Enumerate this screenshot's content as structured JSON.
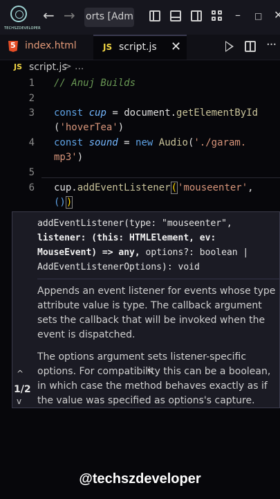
{
  "brand": {
    "logo_text": "TECHSZDEVELOPER"
  },
  "titlebar": {
    "back_icon": "←",
    "forward_icon": "→",
    "command_center_text": "orts [Admini"
  },
  "tabs": [
    {
      "label": "index.html",
      "icon": "html5-icon",
      "active": false
    },
    {
      "label": "script.js",
      "icon": "js-icon",
      "active": true,
      "close": "✕"
    }
  ],
  "breadcrumb": {
    "file": "script.js",
    "separator": ">",
    "more": "..."
  },
  "editor": {
    "line_numbers": [
      "1",
      "2",
      "3",
      "4",
      "5",
      "6"
    ],
    "line1": "// Anuj Builds",
    "line3": {
      "kw": "const",
      "var": "cup",
      "eq": " = ",
      "obj": "document.",
      "fn": "getElementById",
      "wrap_open": "(",
      "str": "'hoverTea'",
      "wrap_close": ")"
    },
    "line4": {
      "kw": "const",
      "var": "sound",
      "eq": " = ",
      "kw2": "new",
      "cls": "Audio",
      "open": "(",
      "str1": "'./garam.",
      "str2": "mp3'",
      "close": ")"
    },
    "line6": {
      "obj": "cup.",
      "fn": "addEventListener",
      "open": "(",
      "str": "'mouseenter'",
      "comma": ",",
      "cont": "()"
    }
  },
  "popup": {
    "signature_line1": "addEventListener(type: \"mouseenter\",",
    "signature_line2_bold": "listener: (this: HTMLElement, ev:",
    "signature_line3_bold": "MouseEvent) => any,",
    "signature_line3_rest": " options?: boolean |",
    "signature_line4": "AddEventListenerOptions): void",
    "doc1": "Appends an event listener for events whose type attribute value is type. The callback argument sets the callback that will be invoked when the event is dispatched.",
    "doc2": "The options argument sets listener-specific options. For compatibility this can be a boolean, in which case the method behaves exactly as if the value was specified as options's capture.",
    "pager": "1/2",
    "pager_up": "^",
    "pager_down": "v"
  },
  "watermark": "@techszdeveloper"
}
